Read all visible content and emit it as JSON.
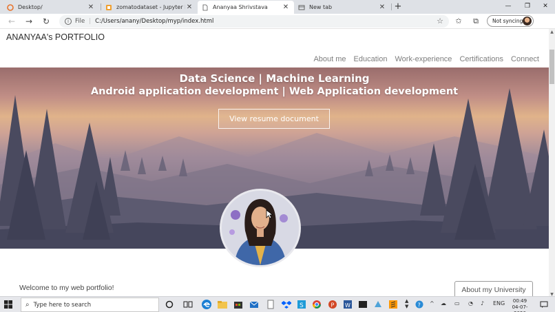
{
  "browser": {
    "tabs": [
      {
        "title": "Desktop/",
        "icon": "desktop-favicon-icon"
      },
      {
        "title": "zomatodataset - Jupyter Notebo",
        "icon": "jupyter-favicon-icon"
      },
      {
        "title": "Ananyaa Shrivstava",
        "icon": "document-favicon-icon",
        "active": true
      },
      {
        "title": "New tab",
        "icon": "newtab-favicon-icon"
      }
    ],
    "tab_close": "✕",
    "new_tab": "+",
    "window_controls": {
      "minimize": "—",
      "maximize": "❐",
      "close": "✕"
    },
    "address": {
      "scheme_label": "File",
      "info_glyph": "i",
      "url": "C:/Users/anany/Desktop/myp/index.html"
    },
    "sync_label": "Not syncing",
    "menu_glyph": "···"
  },
  "page": {
    "brand": "ANANYAA's PORTFOLIO",
    "nav": [
      "About me",
      "Education",
      "Work-experience",
      "Certifications",
      "Connect"
    ],
    "hero": {
      "line1": "Data Science | Machine Learning",
      "line2": "Android application development | Web Application development",
      "button": "View resume document"
    },
    "welcome": "Welcome to my web portfolio!",
    "university_button": "About my University"
  },
  "taskbar": {
    "search_placeholder": "Type here to search",
    "language": "ENG",
    "time": "00:49",
    "date": "04-07-2020"
  },
  "colors": {
    "nav_text": "#7d7d7d",
    "hero_sky_top": "#9a6d6c",
    "hero_sky_glow": "#e0b38a",
    "hero_ground": "#42435a",
    "taskbar": "#e6e7eb"
  }
}
